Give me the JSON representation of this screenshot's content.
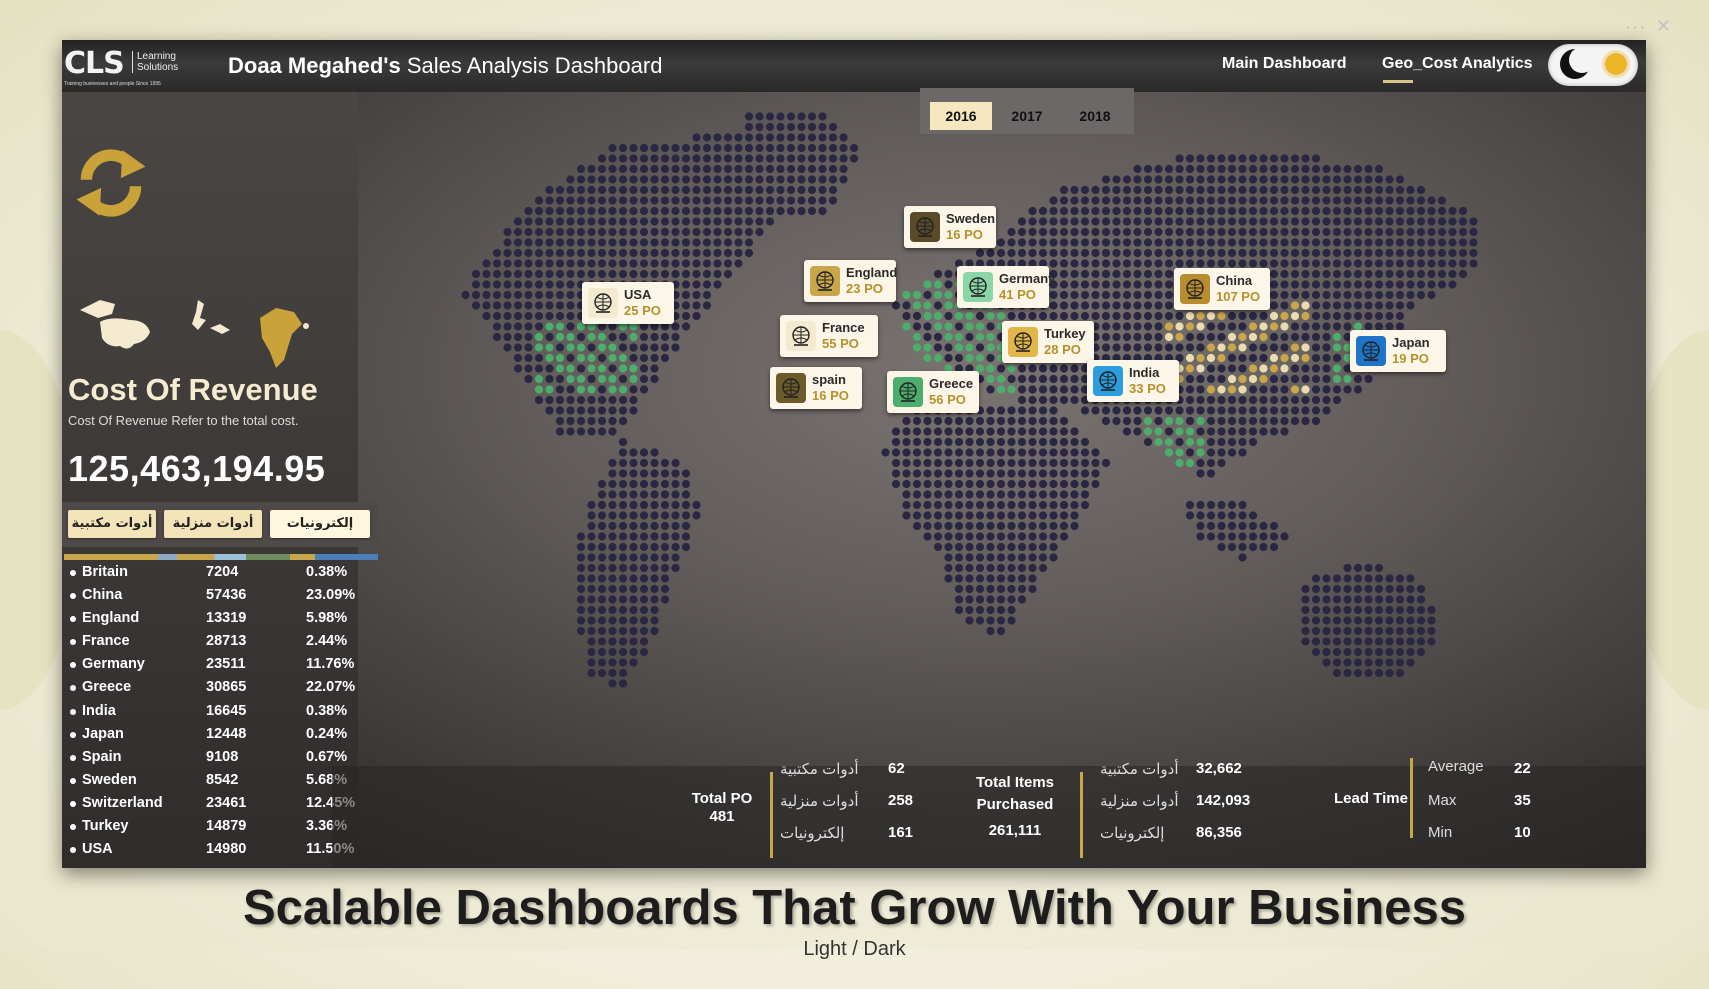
{
  "window": {
    "more_glyph": "···",
    "close_glyph": "✕"
  },
  "header": {
    "logo_main": "CLS",
    "logo_sub_1": "Learning",
    "logo_sub_2": "Solutions",
    "logo_tagline": "Training businesses and people Since 1995",
    "title_owner": "Doaa Megahed's",
    "title_rest": " Sales Analysis Dashboard",
    "nav": {
      "main": "Main Dashboard",
      "geo": "Geo_Cost Analytics",
      "active": "geo"
    }
  },
  "left_panel": {
    "section_title": "Cost Of Revenue",
    "description": "Cost Of Revenue Refer to the total cost.",
    "total_value": "125,463,194.95",
    "categories": [
      {
        "label": "أدوات مكتبية",
        "active": false
      },
      {
        "label": "أدوات منزلية",
        "active": false
      },
      {
        "label": "إلكترونيات",
        "active": true
      }
    ],
    "countries": [
      {
        "name": "Britain",
        "value": "7204",
        "pct": "0.38%"
      },
      {
        "name": "China",
        "value": "57436",
        "pct": "23.09%"
      },
      {
        "name": "England",
        "value": "13319",
        "pct": "5.98%"
      },
      {
        "name": "France",
        "value": "28713",
        "pct": "2.44%"
      },
      {
        "name": "Germany",
        "value": "23511",
        "pct": "11.76%"
      },
      {
        "name": "Greece",
        "value": "30865",
        "pct": "22.07%"
      },
      {
        "name": "India",
        "value": "16645",
        "pct": "0.38%"
      },
      {
        "name": "Japan",
        "value": "12448",
        "pct": "0.24%"
      },
      {
        "name": "Spain",
        "value": "9108",
        "pct": "0.67%"
      },
      {
        "name": "Sweden",
        "value": "8542",
        "pct": "5.68%"
      },
      {
        "name": "Switzerland",
        "value": "23461",
        "pct": "12.45%"
      },
      {
        "name": "Turkey",
        "value": "14879",
        "pct": "3.36%"
      },
      {
        "name": "USA",
        "value": "14980",
        "pct": "11.50%"
      }
    ]
  },
  "years": {
    "items": [
      "2016",
      "2017",
      "2018"
    ],
    "active": "2016"
  },
  "map_badges": [
    {
      "name": "USA",
      "po": "25 PO",
      "icon_color": "#f3ead0"
    },
    {
      "name": "England",
      "po": "23 PO",
      "icon_color": "#c9a64a"
    },
    {
      "name": "France",
      "po": "55 PO",
      "icon_color": "#f3ead0"
    },
    {
      "name": "spain",
      "po": "16 PO",
      "icon_color": "#6b5a2a"
    },
    {
      "name": "Sweden",
      "po": "16 PO",
      "icon_color": "#5b4a2a"
    },
    {
      "name": "Germany",
      "po": "41 PO",
      "icon_color": "#8ad6a6"
    },
    {
      "name": "Greece",
      "po": "56 PO",
      "icon_color": "#4cae6c"
    },
    {
      "name": "Turkey",
      "po": "28 PO",
      "icon_color": "#e3b64a"
    },
    {
      "name": "India",
      "po": "33 PO",
      "icon_color": "#2b9ee0"
    },
    {
      "name": "China",
      "po": "107 PO",
      "icon_color": "#b88d2e"
    },
    {
      "name": "Japan",
      "po": "19 PO",
      "icon_color": "#1d74c8"
    }
  ],
  "stats": {
    "total_po": {
      "label": "Total PO",
      "value": "481",
      "rows": [
        {
          "label": "أدوات مكتبية",
          "value": "62"
        },
        {
          "label": "أدوات منزلية",
          "value": "258"
        },
        {
          "label": "إلكترونيات",
          "value": "161"
        }
      ]
    },
    "total_items": {
      "label_1": "Total Items",
      "label_2": "Purchased",
      "value": "261,111",
      "rows": [
        {
          "label": "أدوات مكتبية",
          "value": "32,662"
        },
        {
          "label": "أدوات منزلية",
          "value": "142,093"
        },
        {
          "label": "إلكترونيات",
          "value": "86,356"
        }
      ]
    },
    "lead_time": {
      "label": "Lead Time",
      "rows": [
        {
          "label": "Average",
          "value": "22"
        },
        {
          "label": "Max",
          "value": "35"
        },
        {
          "label": "Min",
          "value": "10"
        }
      ]
    }
  },
  "footer": {
    "headline": "Scalable Dashboards That Grow With Your Business",
    "subline": "Light / Dark"
  },
  "colors": {
    "accent_gold": "#c9a64a",
    "green_dots": "#4cae6c",
    "map_dots": "#2a2742"
  }
}
